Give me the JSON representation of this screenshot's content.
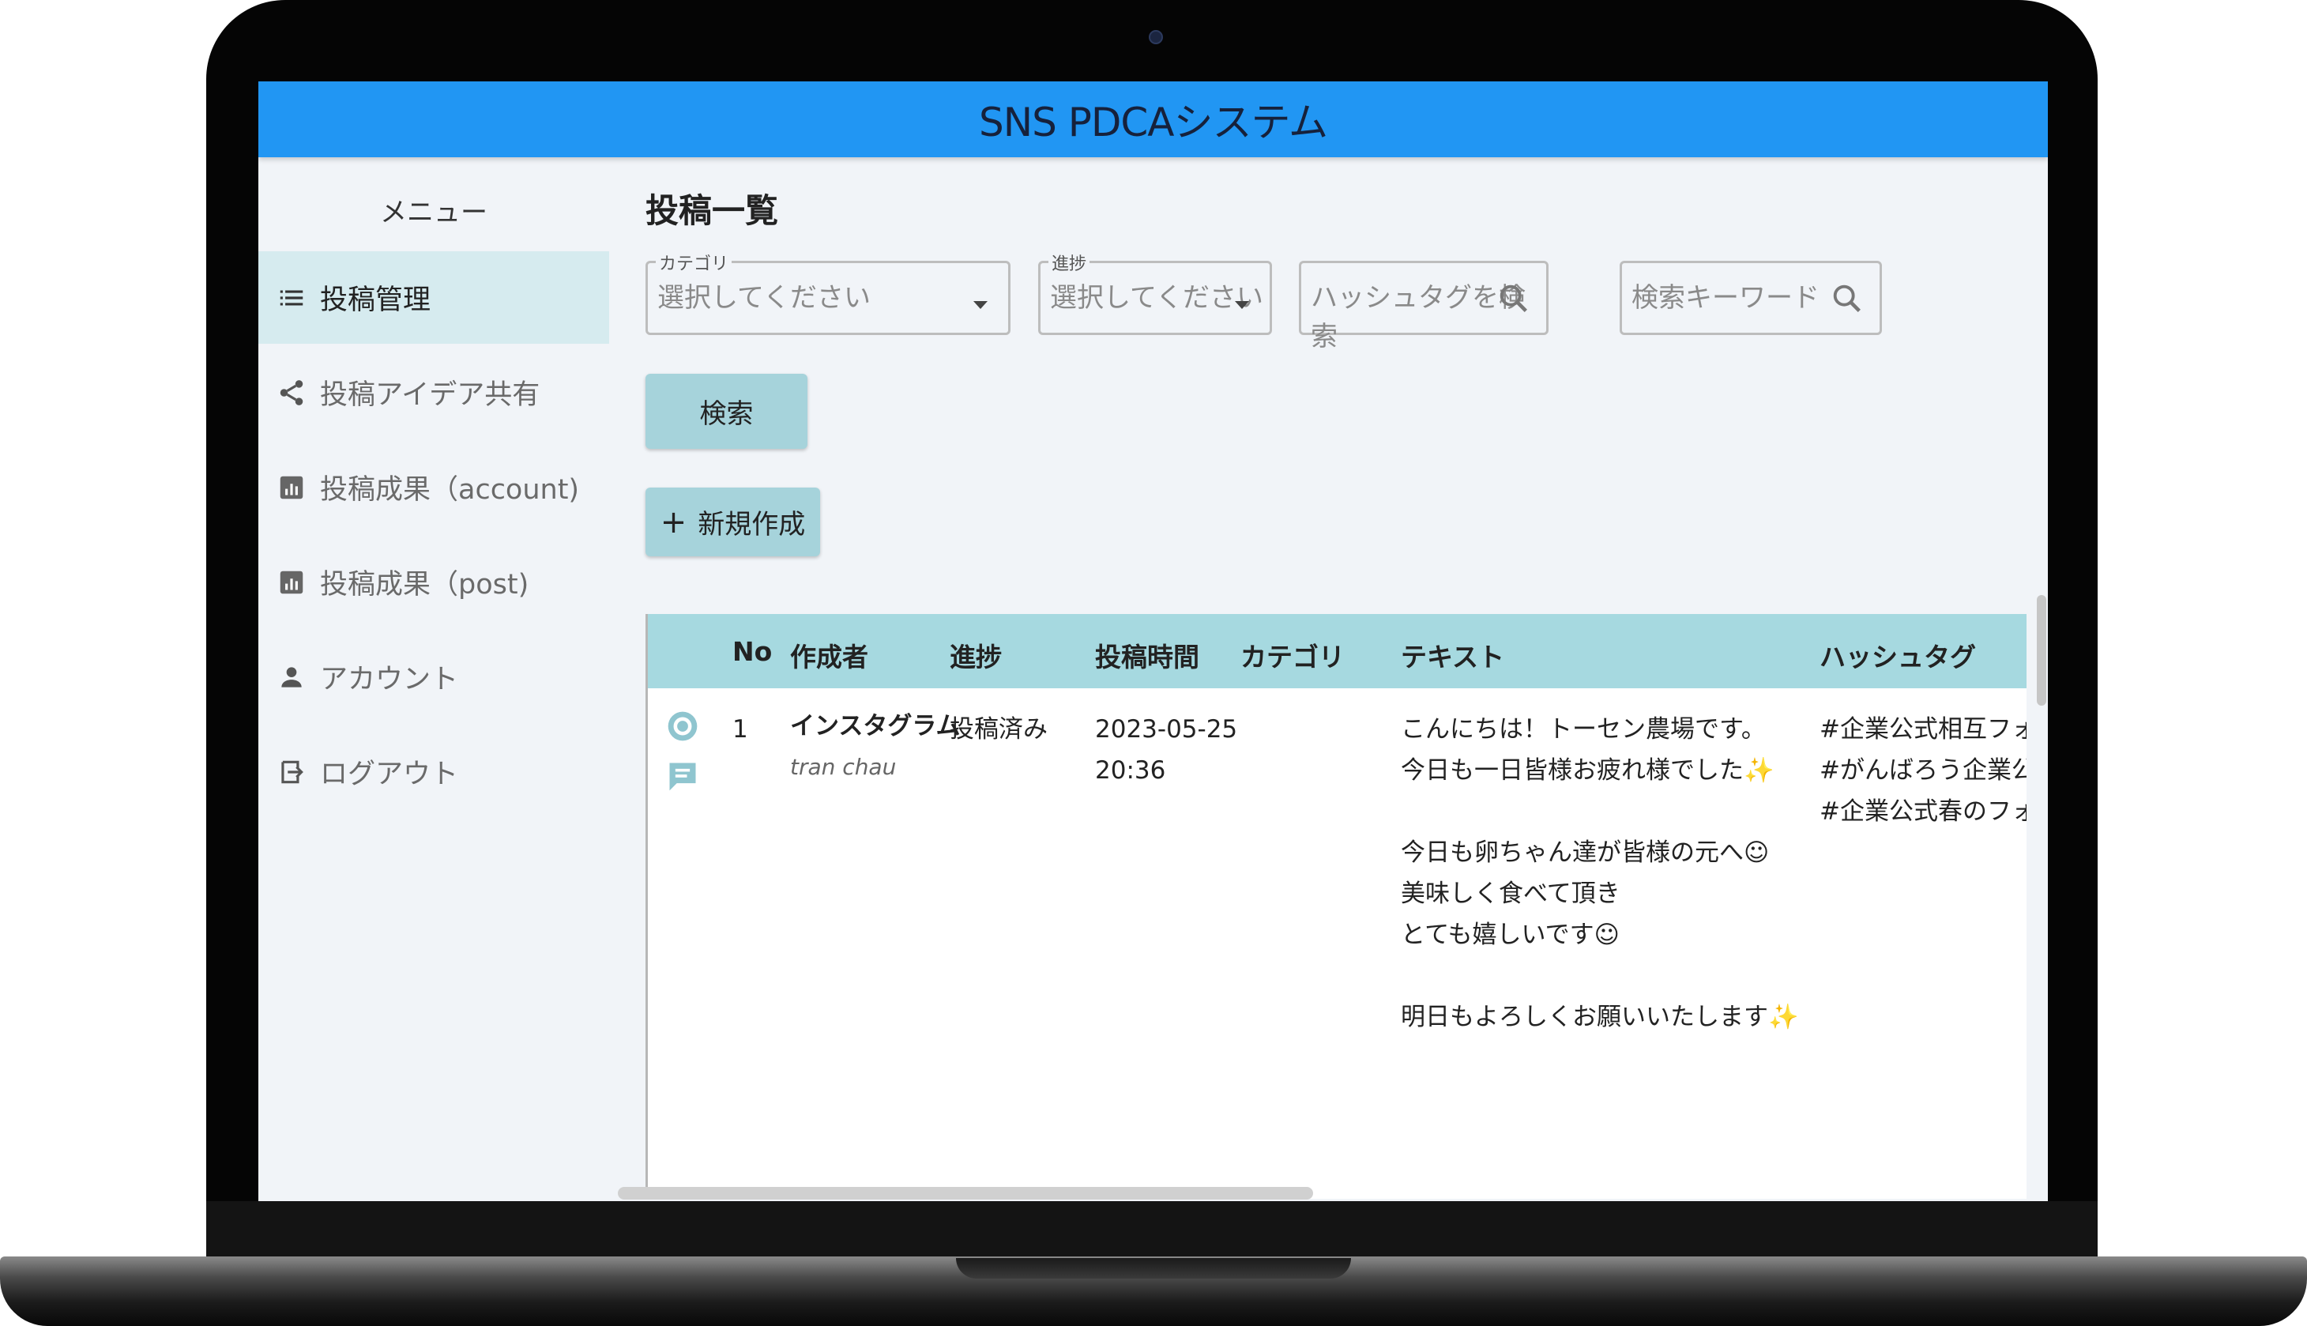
{
  "app": {
    "title": "SNS PDCAシステム"
  },
  "sidebar": {
    "title": "メニュー",
    "items": [
      {
        "label": "投稿管理",
        "icon": "list-icon",
        "active": true
      },
      {
        "label": "投稿アイデア共有",
        "icon": "share-icon",
        "active": false
      },
      {
        "label": "投稿成果（account)",
        "icon": "bar-chart-icon",
        "active": false
      },
      {
        "label": "投稿成果（post)",
        "icon": "bar-chart-icon",
        "active": false
      },
      {
        "label": "アカウント",
        "icon": "person-icon",
        "active": false
      },
      {
        "label": "ログアウト",
        "icon": "logout-icon",
        "active": false
      }
    ]
  },
  "main": {
    "title": "投稿一覧",
    "filters": {
      "category": {
        "label": "カテゴリ",
        "value": "選択してください"
      },
      "progress": {
        "label": "進捗",
        "value": "選択してください"
      },
      "hashtag": {
        "placeholder": "ハッシュタグを検索"
      },
      "keyword": {
        "placeholder": "検索キーワード"
      }
    },
    "search_button": "検索",
    "new_button": {
      "icon": "plus-icon",
      "label": "新規作成"
    },
    "table": {
      "headers": [
        "No",
        "作成者",
        "進捗",
        "投稿時間",
        "カテゴリ",
        "テキスト",
        "ハッシュタグ"
      ],
      "rows": [
        {
          "no": "1",
          "author": "インスタグラム",
          "author_sub": "tran chau",
          "progress": "投稿済み",
          "date": "2023-05-25",
          "time": "20:36",
          "category": "",
          "text_lines": [
            "こんにちは！トーセン農場です。",
            "今日も一日皆様お疲れ様でした✨",
            "",
            "今日も卵ちゃん達が皆様の元へ☺",
            "美味しく食べて頂き",
            "とても嬉しいです☺",
            "",
            "明日もよろしくお願いいたします✨"
          ],
          "hashtags": [
            "#企業公式相互フォロ",
            "#がんばろう企業公式",
            "#企業公式春のフォロ"
          ],
          "action_icons": [
            "eye-icon",
            "comment-icon"
          ]
        }
      ]
    }
  }
}
